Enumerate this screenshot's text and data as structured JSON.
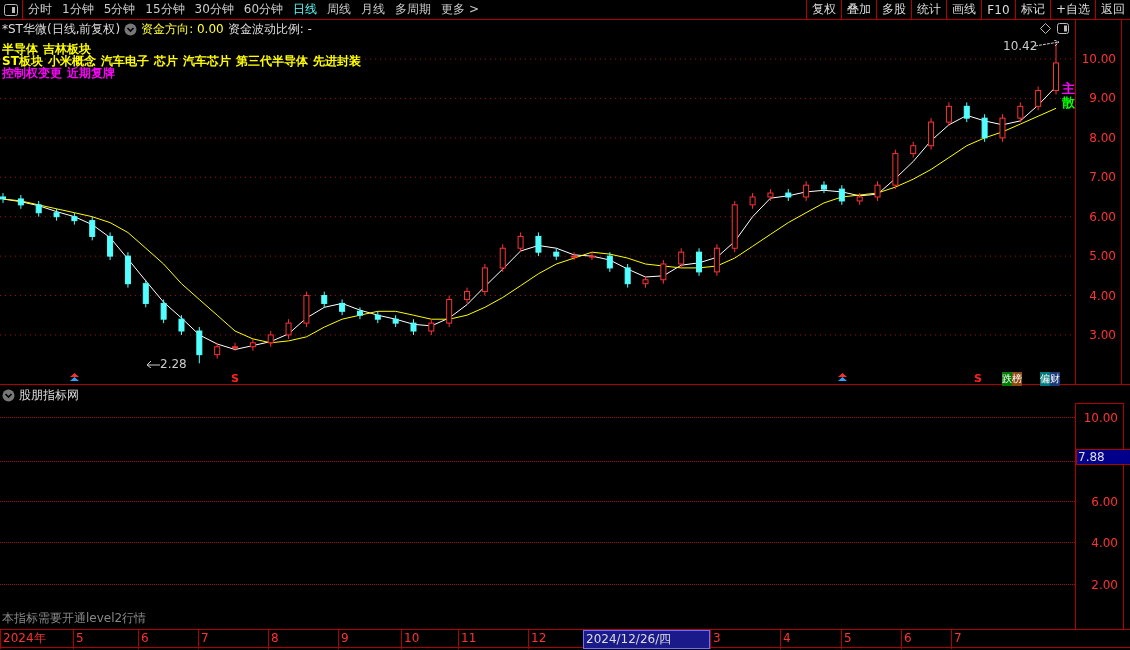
{
  "toolbar": {
    "periods": [
      {
        "label": "分时",
        "selected": false
      },
      {
        "label": "1分钟",
        "selected": false
      },
      {
        "label": "5分钟",
        "selected": false
      },
      {
        "label": "15分钟",
        "selected": false
      },
      {
        "label": "30分钟",
        "selected": false
      },
      {
        "label": "60分钟",
        "selected": false
      },
      {
        "label": "日线",
        "selected": true
      },
      {
        "label": "周线",
        "selected": false
      },
      {
        "label": "月线",
        "selected": false
      },
      {
        "label": "多周期",
        "selected": false
      },
      {
        "label": "更多 >",
        "selected": false
      }
    ],
    "buttons": [
      "复权",
      "叠加",
      "多股",
      "统计",
      "画线",
      "F10",
      "标记",
      "+自选",
      "返回"
    ]
  },
  "header": {
    "stock": "*ST华微(日线,前复权)",
    "fund_direction": "资金方向: 0.00",
    "fund_ratio": "资金波动比例: -"
  },
  "tag_rows": [
    {
      "color": "#ffff00",
      "tags": [
        "半导体",
        "吉林板块"
      ]
    },
    {
      "color": "#ffff00",
      "tags": [
        "ST板块",
        "小米概念",
        "汽车电子",
        "芯片",
        "汽车芯片",
        "第三代半导体",
        "先进封装"
      ]
    },
    {
      "color": "#ff00ff",
      "tags": [
        "控制权变更",
        "近期复牌"
      ]
    }
  ],
  "main_chart": {
    "high_label": "10.42",
    "low_label": "2.28",
    "side_marks": [
      {
        "text": "主",
        "color": "#ff00ff"
      },
      {
        "text": "散",
        "color": "#00ff00"
      }
    ],
    "chart_data": {
      "type": "candlestick",
      "grid": true,
      "ylim": [
        1.73,
        10.99
      ],
      "ohlc": [
        [
          6.5,
          6.6,
          6.35,
          6.45
        ],
        [
          6.45,
          6.55,
          6.2,
          6.3
        ],
        [
          6.3,
          6.4,
          6.0,
          6.1
        ],
        [
          6.1,
          6.2,
          5.9,
          6.0
        ],
        [
          6.0,
          6.1,
          5.8,
          5.9
        ],
        [
          5.9,
          6.0,
          5.4,
          5.5
        ],
        [
          5.5,
          5.6,
          4.9,
          5.0
        ],
        [
          5.0,
          5.1,
          4.2,
          4.3
        ],
        [
          4.3,
          4.4,
          3.7,
          3.8
        ],
        [
          3.8,
          3.9,
          3.3,
          3.4
        ],
        [
          3.4,
          3.5,
          3.0,
          3.1
        ],
        [
          3.1,
          3.2,
          2.28,
          2.5
        ],
        [
          2.5,
          2.8,
          2.4,
          2.7
        ],
        [
          2.7,
          2.8,
          2.6,
          2.7
        ],
        [
          2.7,
          2.9,
          2.6,
          2.8
        ],
        [
          2.8,
          3.1,
          2.7,
          3.0
        ],
        [
          3.0,
          3.4,
          2.9,
          3.3
        ],
        [
          3.3,
          4.1,
          3.2,
          4.0
        ],
        [
          4.0,
          4.1,
          3.7,
          3.8
        ],
        [
          3.8,
          3.9,
          3.5,
          3.6
        ],
        [
          3.6,
          3.7,
          3.4,
          3.5
        ],
        [
          3.5,
          3.6,
          3.3,
          3.4
        ],
        [
          3.4,
          3.5,
          3.2,
          3.3
        ],
        [
          3.3,
          3.4,
          3.0,
          3.1
        ],
        [
          3.1,
          3.4,
          3.0,
          3.3
        ],
        [
          3.3,
          4.0,
          3.2,
          3.9
        ],
        [
          3.9,
          4.2,
          3.8,
          4.1
        ],
        [
          4.1,
          4.8,
          4.0,
          4.7
        ],
        [
          4.7,
          5.3,
          4.6,
          5.2
        ],
        [
          5.2,
          5.6,
          5.1,
          5.5
        ],
        [
          5.5,
          5.6,
          5.0,
          5.1
        ],
        [
          5.1,
          5.2,
          4.9,
          5.0
        ],
        [
          5.0,
          5.1,
          4.9,
          5.0
        ],
        [
          5.0,
          5.1,
          4.9,
          5.0
        ],
        [
          5.0,
          5.1,
          4.6,
          4.7
        ],
        [
          4.7,
          4.8,
          4.2,
          4.3
        ],
        [
          4.3,
          4.5,
          4.2,
          4.4
        ],
        [
          4.4,
          4.9,
          4.3,
          4.8
        ],
        [
          4.8,
          5.2,
          4.7,
          5.1
        ],
        [
          5.1,
          5.2,
          4.5,
          4.6
        ],
        [
          4.6,
          5.3,
          4.5,
          5.2
        ],
        [
          5.2,
          6.4,
          5.1,
          6.3
        ],
        [
          6.3,
          6.6,
          6.2,
          6.5
        ],
        [
          6.5,
          6.7,
          6.4,
          6.6
        ],
        [
          6.6,
          6.7,
          6.4,
          6.5
        ],
        [
          6.5,
          6.9,
          6.4,
          6.8
        ],
        [
          6.8,
          6.9,
          6.6,
          6.7
        ],
        [
          6.7,
          6.8,
          6.3,
          6.4
        ],
        [
          6.4,
          6.6,
          6.3,
          6.5
        ],
        [
          6.5,
          6.9,
          6.4,
          6.8
        ],
        [
          6.8,
          7.7,
          6.7,
          7.6
        ],
        [
          7.6,
          7.9,
          7.5,
          7.8
        ],
        [
          7.8,
          8.5,
          7.7,
          8.4
        ],
        [
          8.4,
          8.9,
          8.3,
          8.8
        ],
        [
          8.8,
          8.9,
          8.4,
          8.5
        ],
        [
          8.5,
          8.6,
          7.9,
          8.0
        ],
        [
          8.0,
          8.6,
          7.9,
          8.5
        ],
        [
          8.5,
          8.9,
          8.4,
          8.8
        ],
        [
          8.8,
          9.3,
          8.7,
          9.2
        ],
        [
          9.2,
          10.42,
          9.1,
          9.9
        ]
      ],
      "yticks": [
        {
          "value": 10,
          "label": "10.00"
        },
        {
          "value": 9,
          "label": "9.00"
        },
        {
          "value": 8,
          "label": "8.00"
        },
        {
          "value": 7,
          "label": "7.00"
        },
        {
          "value": 6,
          "label": "6.00"
        },
        {
          "value": 5,
          "label": "5.00"
        },
        {
          "value": 4,
          "label": "4.00"
        },
        {
          "value": 3,
          "label": "3.00"
        }
      ],
      "series": [
        {
          "type": "line",
          "color": "#ffffff",
          "values": [
            6.45,
            6.38,
            6.28,
            6.13,
            6.0,
            5.8,
            5.47,
            4.93,
            4.37,
            3.83,
            3.43,
            3.0,
            2.77,
            2.63,
            2.73,
            2.83,
            3.03,
            3.43,
            3.7,
            3.8,
            3.63,
            3.5,
            3.4,
            3.27,
            3.23,
            3.43,
            3.77,
            4.23,
            4.67,
            5.13,
            5.27,
            5.2,
            5.03,
            5.0,
            4.9,
            4.67,
            4.47,
            4.5,
            4.77,
            4.83,
            4.97,
            5.37,
            6.0,
            6.47,
            6.53,
            6.63,
            6.67,
            6.63,
            6.53,
            6.57,
            6.97,
            7.4,
            7.93,
            8.33,
            8.57,
            8.43,
            8.33,
            8.43,
            8.83,
            9.3
          ]
        },
        {
          "type": "line",
          "color": "#ffff00",
          "values": [
            6.45,
            6.4,
            6.3,
            6.2,
            6.1,
            6.0,
            5.85,
            5.6,
            5.2,
            4.8,
            4.3,
            3.9,
            3.5,
            3.1,
            2.9,
            2.8,
            2.85,
            2.95,
            3.2,
            3.4,
            3.5,
            3.6,
            3.6,
            3.5,
            3.4,
            3.4,
            3.5,
            3.7,
            3.95,
            4.25,
            4.55,
            4.8,
            4.95,
            5.1,
            5.05,
            4.95,
            4.8,
            4.75,
            4.7,
            4.7,
            4.75,
            4.95,
            5.25,
            5.55,
            5.85,
            6.1,
            6.35,
            6.5,
            6.55,
            6.6,
            6.75,
            6.95,
            7.2,
            7.5,
            7.8,
            8.0,
            8.15,
            8.35,
            8.55,
            8.75
          ]
        }
      ]
    }
  },
  "markers": [
    {
      "kind": "arrow"
    },
    {
      "kind": "s",
      "label": "S"
    },
    {
      "kind": "arrow"
    },
    {
      "kind": "s",
      "label": "S"
    },
    {
      "kind": "badge",
      "parts": [
        {
          "text": "跌",
          "color": "#007a00"
        },
        {
          "text": "榜",
          "color": "#8b4a12"
        }
      ]
    },
    {
      "kind": "badge",
      "parts": [
        {
          "text": "偏",
          "color": "#007a7a"
        },
        {
          "text": "财",
          "color": "#1a3a7a"
        }
      ]
    }
  ],
  "lower_panel": {
    "title": "股朋指标网",
    "yticks": [
      "10.00",
      "6.00",
      "4.00",
      "2.00"
    ],
    "value_badge": "7.88",
    "note": "本指标需要开通level2行情"
  },
  "date_axis": [
    {
      "label": "2024年",
      "selected": false
    },
    {
      "label": "5",
      "selected": false
    },
    {
      "label": "6",
      "selected": false
    },
    {
      "label": "7",
      "selected": false
    },
    {
      "label": "8",
      "selected": false
    },
    {
      "label": "9",
      "selected": false
    },
    {
      "label": "10",
      "selected": false
    },
    {
      "label": "11",
      "selected": false
    },
    {
      "label": "12",
      "selected": false
    },
    {
      "label": "2024/12/26/四",
      "selected": true
    },
    {
      "label": "3",
      "selected": false
    },
    {
      "label": "4",
      "selected": false
    },
    {
      "label": "5",
      "selected": false
    },
    {
      "label": "6",
      "selected": false
    },
    {
      "label": "7",
      "selected": false
    }
  ]
}
